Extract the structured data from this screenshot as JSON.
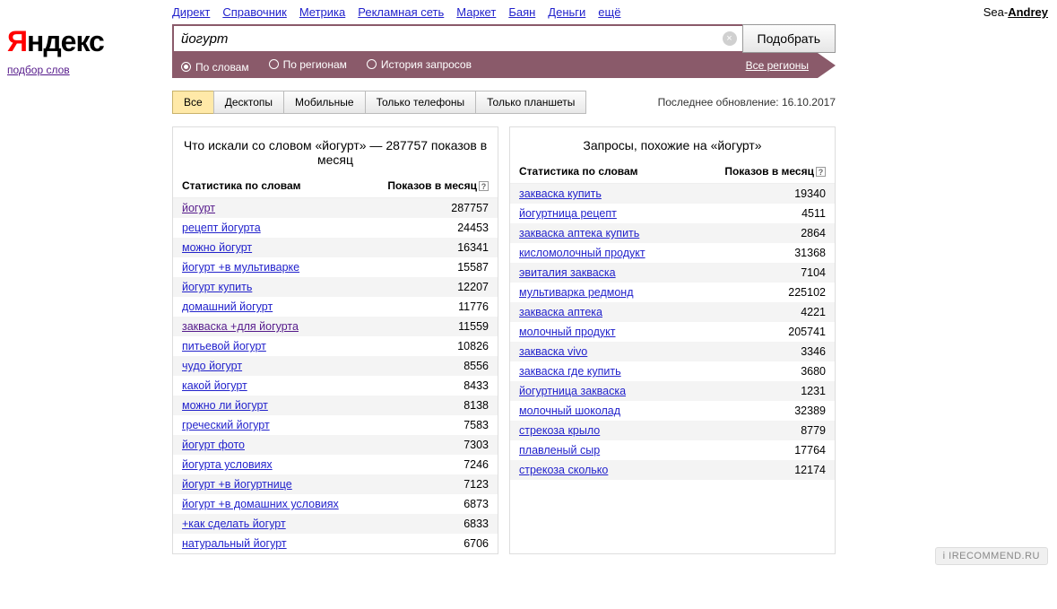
{
  "topnav": [
    "Директ",
    "Справочник",
    "Метрика",
    "Рекламная сеть",
    "Маркет",
    "Баян",
    "Деньги",
    "ещё"
  ],
  "user": {
    "prefix": "Sea-",
    "name": "Andrey"
  },
  "logo": {
    "text1": "Я",
    "text2": "ндекс",
    "sub": "подбор слов"
  },
  "search": {
    "value": "йогурт",
    "submit": "Подобрать"
  },
  "subbar": {
    "radios": [
      {
        "label": "По словам",
        "selected": true
      },
      {
        "label": "По регионам",
        "selected": false
      },
      {
        "label": "История запросов",
        "selected": false
      }
    ],
    "all_regions": "Все регионы"
  },
  "tabs": [
    "Все",
    "Десктопы",
    "Мобильные",
    "Только телефоны",
    "Только планшеты"
  ],
  "active_tab": 0,
  "updated": "Последнее обновление: 16.10.2017",
  "left_panel": {
    "title": "Что искали со словом «йогурт» — 287757 показов в месяц",
    "col1": "Статистика по словам",
    "col2": "Показов в месяц",
    "rows": [
      {
        "term": "йогурт",
        "count": 287757,
        "visited": true
      },
      {
        "term": "рецепт йогурта",
        "count": 24453
      },
      {
        "term": "можно йогурт",
        "count": 16341
      },
      {
        "term": "йогурт +в мультиварке",
        "count": 15587
      },
      {
        "term": "йогурт купить",
        "count": 12207
      },
      {
        "term": "домашний йогурт",
        "count": 11776
      },
      {
        "term": "закваска +для йогурта",
        "count": 11559,
        "visited": true
      },
      {
        "term": "питьевой йогурт",
        "count": 10826
      },
      {
        "term": "чудо йогурт",
        "count": 8556
      },
      {
        "term": "какой йогурт",
        "count": 8433
      },
      {
        "term": "можно ли йогурт",
        "count": 8138
      },
      {
        "term": "греческий йогурт",
        "count": 7583
      },
      {
        "term": "йогурт фото",
        "count": 7303
      },
      {
        "term": "йогурта условиях",
        "count": 7246
      },
      {
        "term": "йогурт +в йогуртнице",
        "count": 7123
      },
      {
        "term": "йогурт +в домашних условиях",
        "count": 6873
      },
      {
        "term": "+как сделать йогурт",
        "count": 6833
      },
      {
        "term": "натуральный йогурт",
        "count": 6706
      }
    ]
  },
  "right_panel": {
    "title": "Запросы, похожие на «йогурт»",
    "col1": "Статистика по словам",
    "col2": "Показов в месяц",
    "rows": [
      {
        "term": "закваска купить",
        "count": 19340
      },
      {
        "term": "йогуртница рецепт",
        "count": 4511
      },
      {
        "term": "закваска аптека купить",
        "count": 2864
      },
      {
        "term": "кисломолочный продукт",
        "count": 31368
      },
      {
        "term": "эвиталия закваска",
        "count": 7104
      },
      {
        "term": "мультиварка редмонд",
        "count": 225102
      },
      {
        "term": "закваска аптека",
        "count": 4221
      },
      {
        "term": "молочный продукт",
        "count": 205741
      },
      {
        "term": "закваска vivo",
        "count": 3346
      },
      {
        "term": "закваска где купить",
        "count": 3680
      },
      {
        "term": "йогуртница закваска",
        "count": 1231
      },
      {
        "term": "молочный шоколад",
        "count": 32389
      },
      {
        "term": "стрекоза крыло",
        "count": 8779
      },
      {
        "term": "плавленый сыр",
        "count": 17764
      },
      {
        "term": "стрекоза сколько",
        "count": 12174
      }
    ]
  },
  "watermark": "i IRECOMMEND.RU"
}
